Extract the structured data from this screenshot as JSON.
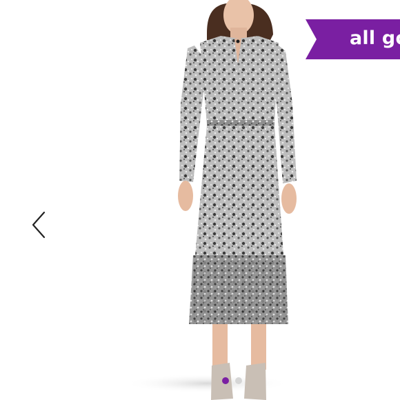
{
  "badge": {
    "label": "all gone"
  },
  "carousel": {
    "prev_icon": "chevron-left-icon",
    "slide_count": 2,
    "active_index": 0,
    "active_color": "#7a1fa2",
    "inactive_color": "#d6d6d6"
  },
  "colors": {
    "badge_bg": "#7a1fa2",
    "badge_text": "#ffffff"
  }
}
